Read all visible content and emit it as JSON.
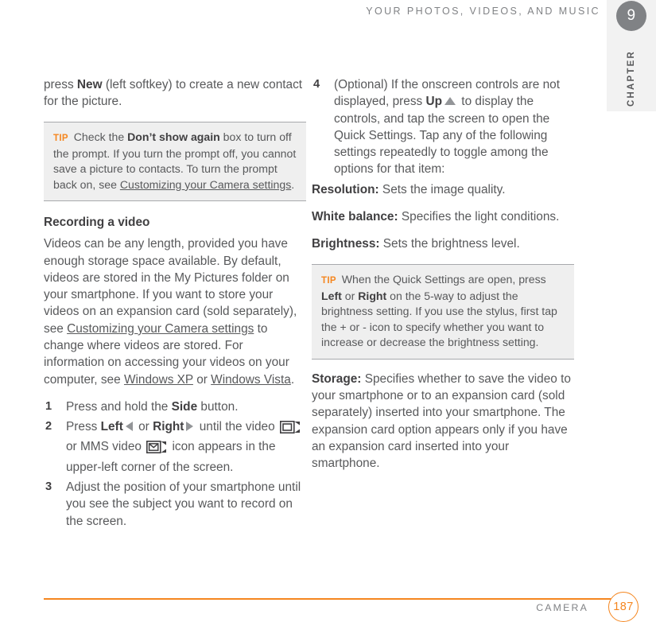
{
  "header": {
    "running_head": "YOUR PHOTOS, VIDEOS, AND MUSIC",
    "chapter_number": "9",
    "chapter_word": "CHAPTER"
  },
  "footer": {
    "section_label": "CAMERA",
    "page_number": "187",
    "rule_color": "#f5861f"
  },
  "colors": {
    "accent_orange": "#f5861f",
    "body_gray": "#58595b",
    "bold_gray": "#414042",
    "tip_background": "#efefef",
    "tip_rule": "#a7a9ac",
    "chapter_badge": "#808285"
  },
  "left_column": {
    "continued_paragraph": {
      "before": "press ",
      "bold": "New",
      "after": " (left softkey) to create a new contact for the picture."
    },
    "tip_1": {
      "label": "TIP",
      "part_1": " Check the ",
      "bold": "Don’t show again",
      "part_2": " box to turn off the prompt. If you turn the prompt off, you cannot save a picture to contacts. To turn the prompt back on, see ",
      "link": "Customizing your Camera settings",
      "part_3": "."
    },
    "heading": "Recording a video",
    "body_paragraph": {
      "part_1": "Videos can be any length, provided you have enough storage space available. By default, videos are stored in the My Pictures folder on your smartphone. If you want to store your videos on an expansion card (sold separately), see ",
      "link_1": "Customizing your Camera settings",
      "part_2": " to change where videos are stored. For information on accessing your videos on your computer, see ",
      "link_2": "Windows XP",
      "part_3": " or ",
      "link_3": "Windows Vista",
      "part_4": "."
    },
    "steps": [
      {
        "number": "1",
        "part_1": "Press and hold the ",
        "bold_1": "Side",
        "part_2": " button."
      },
      {
        "number": "2",
        "part_1": "Press ",
        "bold_1": "Left",
        "icon_1": "triangle-left-icon",
        "part_2": " or ",
        "bold_2": "Right",
        "icon_2": "triangle-right-icon",
        "part_3": " until the video ",
        "icon_3": "video-camera-icon",
        "part_4": " or MMS video ",
        "icon_4": "mms-video-camera-icon",
        "part_5": " icon appears in the upper-left corner of the screen."
      },
      {
        "number": "3",
        "part_1": "Adjust the position of your smartphone until you see the subject you want to record on the screen."
      }
    ]
  },
  "right_column": {
    "step_4": {
      "number": "4",
      "part_1": "(Optional) If the onscreen controls are not displayed, press ",
      "bold_1": "Up",
      "icon_1": "triangle-up-icon",
      "part_2": " to display the controls, and tap the screen to open the Quick Settings. Tap any of the following settings repeatedly to toggle among the options for that item:"
    },
    "settings": [
      {
        "term": "Resolution:",
        "definition": " Sets the image quality."
      },
      {
        "term": "White balance:",
        "definition": " Specifies the light conditions."
      },
      {
        "term": "Brightness:",
        "definition": " Sets the brightness level."
      }
    ],
    "tip_2": {
      "label": "TIP",
      "part_1": " When the Quick Settings are open, press ",
      "bold_1": "Left",
      "part_2": " or ",
      "bold_2": "Right",
      "part_3": " on the 5-way to adjust the brightness setting. If you use the stylus, first tap the + or - icon to specify whether you want to increase or decrease the brightness setting."
    },
    "storage": {
      "term": "Storage:",
      "definition": " Specifies whether to save the video to your smartphone or to an expansion card (sold separately) inserted into your smartphone. The expansion card option appears only if you have an expansion card inserted into your smartphone."
    }
  }
}
